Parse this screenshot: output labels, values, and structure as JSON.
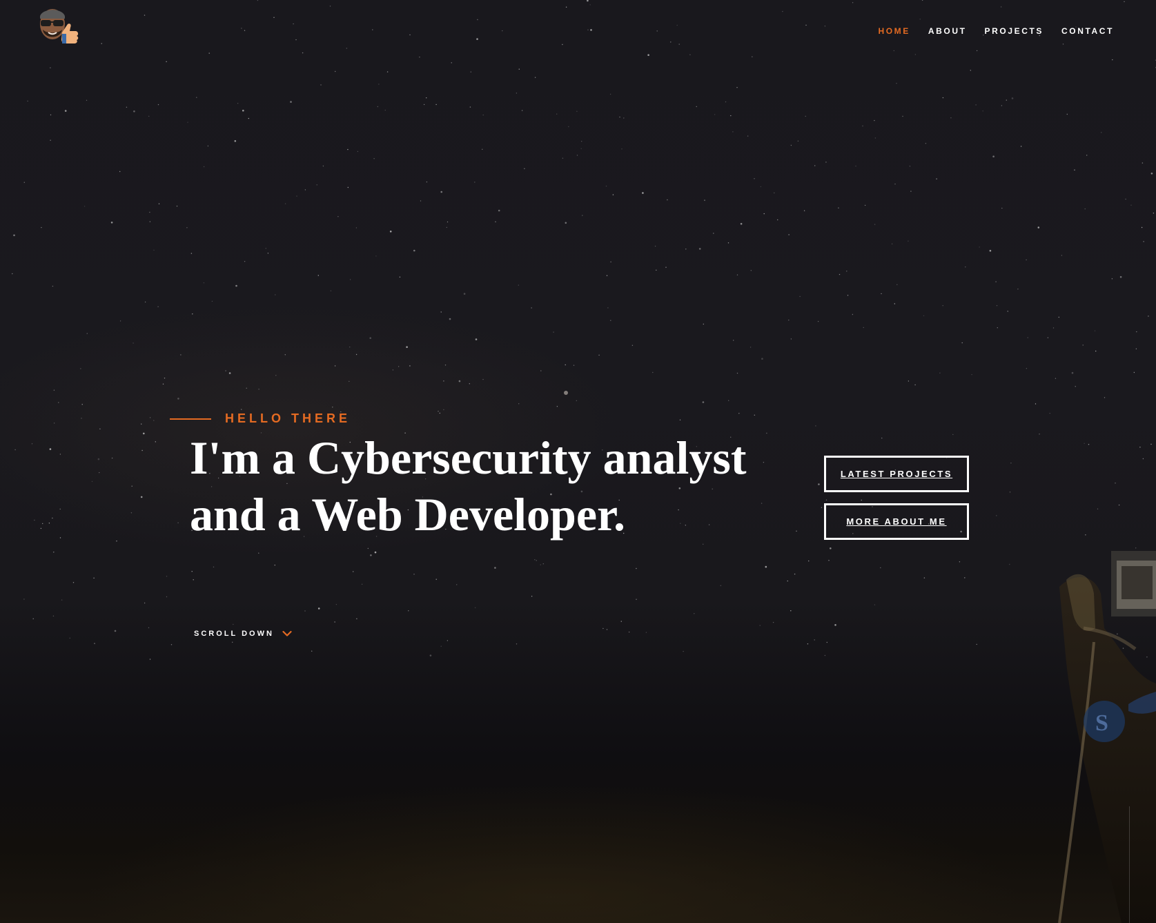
{
  "header": {
    "logo_icon": "memoji-thumbs-up-icon",
    "nav": [
      {
        "label": "HOME",
        "active": true
      },
      {
        "label": "ABOUT",
        "active": false
      },
      {
        "label": "PROJECTS",
        "active": false
      },
      {
        "label": "CONTACT",
        "active": false
      }
    ]
  },
  "hero": {
    "kicker": "HELLO THERE",
    "headline_line1": "I'm a Cybersecurity analyst",
    "headline_line2": "and a Web Developer.",
    "buttons": {
      "latest_projects": "LATEST PROJECTS",
      "more_about_me": "MORE ABOUT ME"
    },
    "scroll_label": "SCROLL DOWN",
    "scroll_icon": "chevron-down-icon"
  },
  "colors": {
    "accent": "#e56b22",
    "background": "#19181d",
    "text": "#ffffff"
  }
}
